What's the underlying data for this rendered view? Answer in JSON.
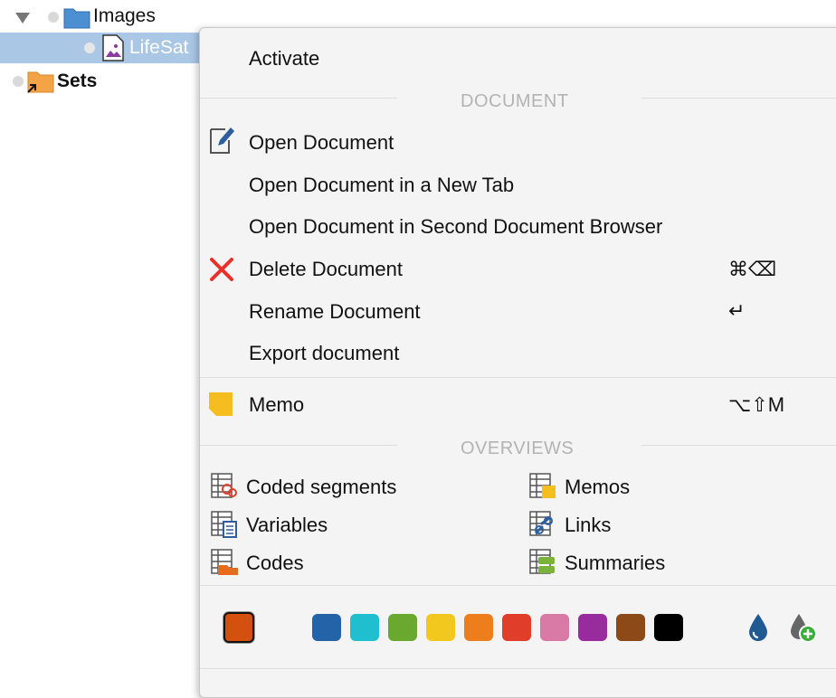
{
  "tree": {
    "items": [
      {
        "label": "Images"
      },
      {
        "label": "LifeSat"
      },
      {
        "label": "Sets"
      }
    ]
  },
  "menu": {
    "activate": "Activate",
    "sections": {
      "document": "DOCUMENT",
      "overviews": "OVERVIEWS"
    },
    "items": {
      "open_document": "Open Document",
      "open_new_tab": "Open Document in a New Tab",
      "open_second_browser": "Open Document in Second Document Browser",
      "delete_document": "Delete Document",
      "delete_shortcut": "⌘⌫",
      "rename_document": "Rename Document",
      "rename_shortcut": "↵",
      "export_document": "Export document",
      "memo": "Memo",
      "memo_shortcut": "⌥⇧M"
    },
    "overviews": {
      "coded_segments": "Coded segments",
      "variables": "Variables",
      "codes": "Codes",
      "memos": "Memos",
      "links": "Links",
      "summaries": "Summaries"
    },
    "colors": {
      "selected": "#d4500f",
      "palette": [
        "#2563a8",
        "#1fbfcf",
        "#6aa82f",
        "#f2c81e",
        "#ee7d1b",
        "#e03e2a",
        "#d97aa6",
        "#982b9e",
        "#8b4a17",
        "#000000"
      ]
    }
  }
}
